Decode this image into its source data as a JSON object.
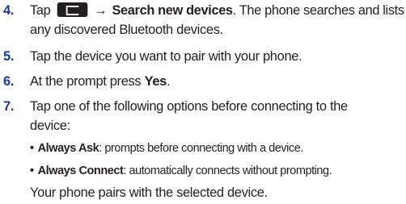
{
  "steps": [
    {
      "number": "4.",
      "prefix": "Tap",
      "icon": "menu-key-icon",
      "arrow": "→",
      "bold_text": "Search new devices",
      "text_after": ". The phone searches and lists",
      "line2": "any discovered Bluetooth devices."
    },
    {
      "number": "5.",
      "text": "Tap the device you want to pair with your phone."
    },
    {
      "number": "6.",
      "text_before": "At the prompt press ",
      "bold_text": "Yes",
      "text_after": "."
    },
    {
      "number": "7.",
      "line1": "Tap one of the following options before connecting to the",
      "line2": "device:"
    }
  ],
  "bullets": [
    {
      "marker": "•",
      "label": "Always Ask",
      "text": ": prompts before connecting with a device."
    },
    {
      "marker": "•",
      "label": "Always Connect",
      "text": ": automatically connects without prompting."
    }
  ],
  "closing": "Your phone pairs with the selected device.",
  "colors": {
    "step_number": "#1d3b8c",
    "body_text": "#231f20",
    "icon_background": "#231f20"
  }
}
